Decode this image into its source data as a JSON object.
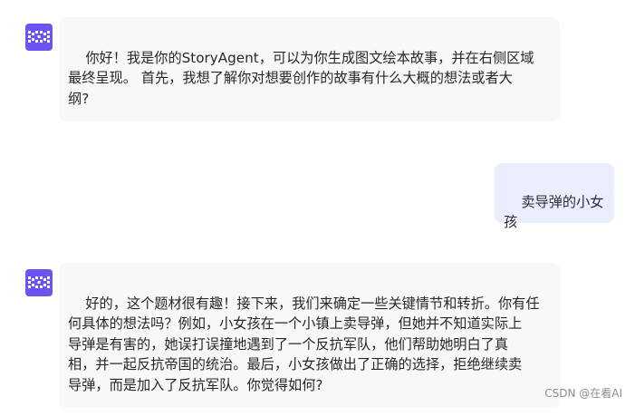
{
  "messages": [
    {
      "role": "agent",
      "avatar_icon": "story-agent-logo-icon",
      "text": "你好！我是你的StoryAgent，可以为你生成图文绘本故事，并在右侧区域\n最终呈现。 首先，我想了解你对想要创作的故事有什么大概的想法或者大\n纲?"
    },
    {
      "role": "user",
      "text": "卖导弹的小女孩"
    },
    {
      "role": "agent",
      "avatar_icon": "story-agent-logo-icon",
      "text": "好的，这个题材很有趣！接下来，我们来确定一些关键情节和转折。你有任\n何具体的想法吗？例如，小女孩在一个小镇上卖导弹，但她并不知道实际上\n导弹是有害的，她误打误撞地遇到了一个反抗军队，他们帮助她明白了真\n相，并一起反抗帝国的统治。最后，小女孩做出了正确的选择，拒绝继续卖\n导弹，而是加入了反抗军队。你觉得如何?"
    }
  ],
  "colors": {
    "avatar_bg": "#6a55f3",
    "agent_bubble_bg": "#f7f8fa",
    "user_bubble_bg": "#ebeefe",
    "text": "#26272b"
  },
  "watermark": "CSDN @在看AI"
}
